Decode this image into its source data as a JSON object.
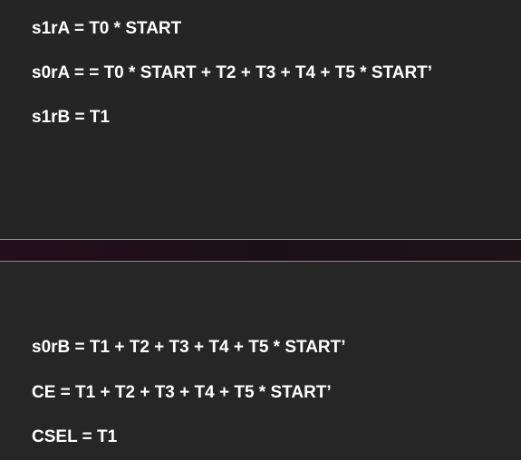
{
  "top_equations": [
    "s1rA = T0 * START",
    "s0rA = = T0 * START + T2 + T3 + T4 + T5 * START’",
    "s1rB = T1"
  ],
  "bottom_equations": [
    "s0rB = T1 + T2 + T3 + T4 + T5 * START’",
    "CE = T1 + T2 + T3 + T4 + T5 * START’",
    "CSEL = T1"
  ],
  "colors": {
    "background": "#262626",
    "text": "#ffffff",
    "divider": "#1b0f17"
  }
}
